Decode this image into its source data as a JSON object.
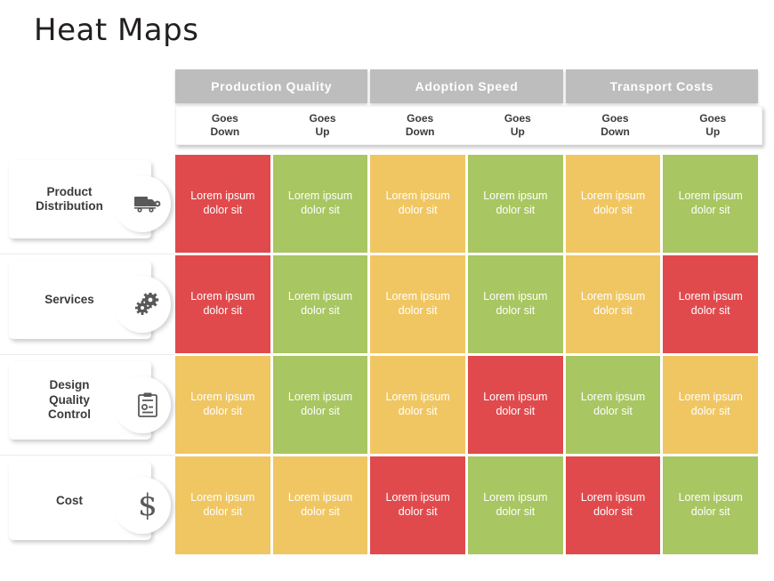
{
  "page": {
    "title": "Heat Maps"
  },
  "colors": {
    "red": "#e04a4d",
    "green": "#a8c661",
    "yellow": "#f0c662",
    "header_gray": "#bdbdbd",
    "text_dark": "#3b3b3b",
    "title": "#231f20"
  },
  "chart_data": {
    "type": "heatmap",
    "title": "Heat Maps",
    "xlabel": "",
    "ylabel": "",
    "grid": false,
    "legend": "none",
    "column_groups": [
      {
        "label": "Production Quality",
        "columns": [
          "Goes Down",
          "Goes Up"
        ]
      },
      {
        "label": "Adoption Speed",
        "columns": [
          "Goes Down",
          "Goes Up"
        ]
      },
      {
        "label": "Transport Costs",
        "columns": [
          "Goes Down",
          "Goes Up"
        ]
      }
    ],
    "columns": [
      "Production Quality / Goes Down",
      "Production Quality / Goes Up",
      "Adoption Speed / Goes Down",
      "Adoption Speed / Goes Up",
      "Transport Costs / Goes Down",
      "Transport Costs / Goes Up"
    ],
    "categories": [
      "Product Distribution",
      "Services",
      "Design Quality Control",
      "Cost"
    ],
    "color_scale": {
      "red": "#e04a4d",
      "yellow": "#f0c662",
      "green": "#a8c661"
    },
    "values": [
      [
        "red",
        "green",
        "yellow",
        "green",
        "yellow",
        "green"
      ],
      [
        "red",
        "green",
        "yellow",
        "green",
        "yellow",
        "red"
      ],
      [
        "yellow",
        "green",
        "yellow",
        "red",
        "green",
        "yellow"
      ],
      [
        "yellow",
        "yellow",
        "red",
        "green",
        "red",
        "green"
      ]
    ],
    "cell_text": "Lorem ipsum dolor sit"
  },
  "header": {
    "groups": [
      {
        "label": "Production Quality"
      },
      {
        "label": "Adoption Speed"
      },
      {
        "label": "Transport Costs"
      }
    ],
    "subcolumns": [
      {
        "line1": "Goes",
        "line2": "Down"
      },
      {
        "line1": "Goes",
        "line2": "Up"
      },
      {
        "line1": "Goes",
        "line2": "Down"
      },
      {
        "line1": "Goes",
        "line2": "Up"
      },
      {
        "line1": "Goes",
        "line2": "Down"
      },
      {
        "line1": "Goes",
        "line2": "Up"
      }
    ]
  },
  "rows": [
    {
      "label_lines": [
        "Product",
        "Distribution"
      ],
      "icon": "truck-icon",
      "cells": [
        {
          "color": "red",
          "line1": "Lorem ipsum",
          "line2": "dolor sit"
        },
        {
          "color": "green",
          "line1": "Lorem ipsum",
          "line2": "dolor sit"
        },
        {
          "color": "yellow",
          "line1": "Lorem ipsum",
          "line2": "dolor sit"
        },
        {
          "color": "green",
          "line1": "Lorem ipsum",
          "line2": "dolor sit"
        },
        {
          "color": "yellow",
          "line1": "Lorem ipsum",
          "line2": "dolor sit"
        },
        {
          "color": "green",
          "line1": "Lorem ipsum",
          "line2": "dolor sit"
        }
      ]
    },
    {
      "label_lines": [
        "Services"
      ],
      "icon": "gears-icon",
      "cells": [
        {
          "color": "red",
          "line1": "Lorem ipsum",
          "line2": "dolor sit"
        },
        {
          "color": "green",
          "line1": "Lorem ipsum",
          "line2": "dolor sit"
        },
        {
          "color": "yellow",
          "line1": "Lorem ipsum",
          "line2": "dolor sit"
        },
        {
          "color": "green",
          "line1": "Lorem ipsum",
          "line2": "dolor sit"
        },
        {
          "color": "yellow",
          "line1": "Lorem ipsum",
          "line2": "dolor sit"
        },
        {
          "color": "red",
          "line1": "Lorem ipsum",
          "line2": "dolor sit"
        }
      ]
    },
    {
      "label_lines": [
        "Design",
        "Quality",
        "Control"
      ],
      "icon": "clipboard-icon",
      "cells": [
        {
          "color": "yellow",
          "line1": "Lorem ipsum",
          "line2": "dolor sit"
        },
        {
          "color": "green",
          "line1": "Lorem ipsum",
          "line2": "dolor sit"
        },
        {
          "color": "yellow",
          "line1": "Lorem ipsum",
          "line2": "dolor sit"
        },
        {
          "color": "red",
          "line1": "Lorem ipsum",
          "line2": "dolor sit"
        },
        {
          "color": "green",
          "line1": "Lorem ipsum",
          "line2": "dolor sit"
        },
        {
          "color": "yellow",
          "line1": "Lorem ipsum",
          "line2": "dolor sit"
        }
      ]
    },
    {
      "label_lines": [
        "Cost"
      ],
      "icon": "dollar-icon",
      "cells": [
        {
          "color": "yellow",
          "line1": "Lorem ipsum",
          "line2": "dolor sit"
        },
        {
          "color": "yellow",
          "line1": "Lorem ipsum",
          "line2": "dolor sit"
        },
        {
          "color": "red",
          "line1": "Lorem ipsum",
          "line2": "dolor sit"
        },
        {
          "color": "green",
          "line1": "Lorem ipsum",
          "line2": "dolor sit"
        },
        {
          "color": "red",
          "line1": "Lorem ipsum",
          "line2": "dolor sit"
        },
        {
          "color": "green",
          "line1": "Lorem ipsum",
          "line2": "dolor sit"
        }
      ]
    }
  ]
}
